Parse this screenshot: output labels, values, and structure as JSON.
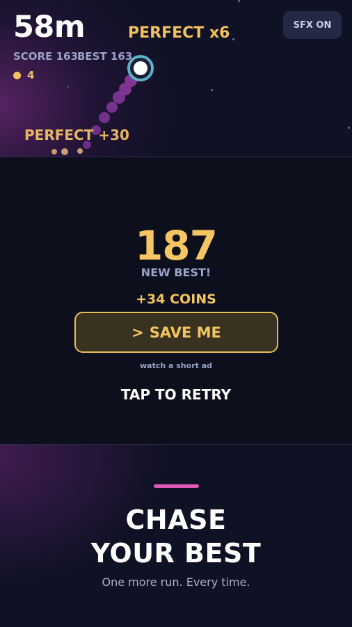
{
  "hud": {
    "distance": "58m",
    "score_label": "SCORE 163",
    "best_label": "BEST 163",
    "coins": "4",
    "perfect_multiplier": "PERFECT x6",
    "perfect_bonus": "PERFECT +30",
    "sfx_label": "SFX ON"
  },
  "results": {
    "final_score": "187",
    "new_best": "NEW BEST!",
    "coins_earned": "+34 COINS",
    "save_me_icon": ">",
    "save_me_label": "SAVE ME",
    "ad_note": "watch a short ad",
    "retry_label": "TAP TO RETRY"
  },
  "promo": {
    "headline_line1": "CHASE",
    "headline_line2": "YOUR BEST",
    "tagline": "One more run. Every time."
  },
  "colors": {
    "background": "#0d0f1c",
    "gold": "#f2c560",
    "muted": "#9aa3c9",
    "trail": "#7b3590",
    "accent": "#e05ab8"
  }
}
